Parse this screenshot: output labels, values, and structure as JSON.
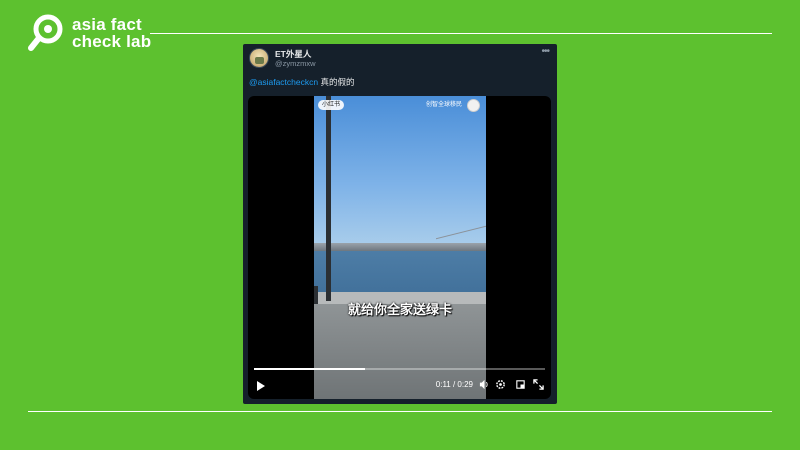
{
  "brand": {
    "line1": "asia fact",
    "line2": "check lab",
    "logo_icon": "magnifier-logo-icon",
    "color": "#ffffff"
  },
  "page": {
    "background": "#5dc12f"
  },
  "tweet": {
    "display_name": "ET外星人",
    "handle": "@zymzmxw",
    "mention": "@asiafactcheckcn",
    "text": " 真的假的",
    "more_icon": "more-horizontal-icon"
  },
  "video": {
    "badge": "小红书",
    "account_label": "创智全球移民",
    "subtitle": "就给你全家送绿卡",
    "elapsed": "0:11",
    "duration": "0:29",
    "time_display": "0:11 / 0:29",
    "progress_fraction": 0.38,
    "icons": [
      "play-icon",
      "volume-icon",
      "settings-icon",
      "picture-in-picture-icon",
      "fullscreen-icon"
    ]
  }
}
